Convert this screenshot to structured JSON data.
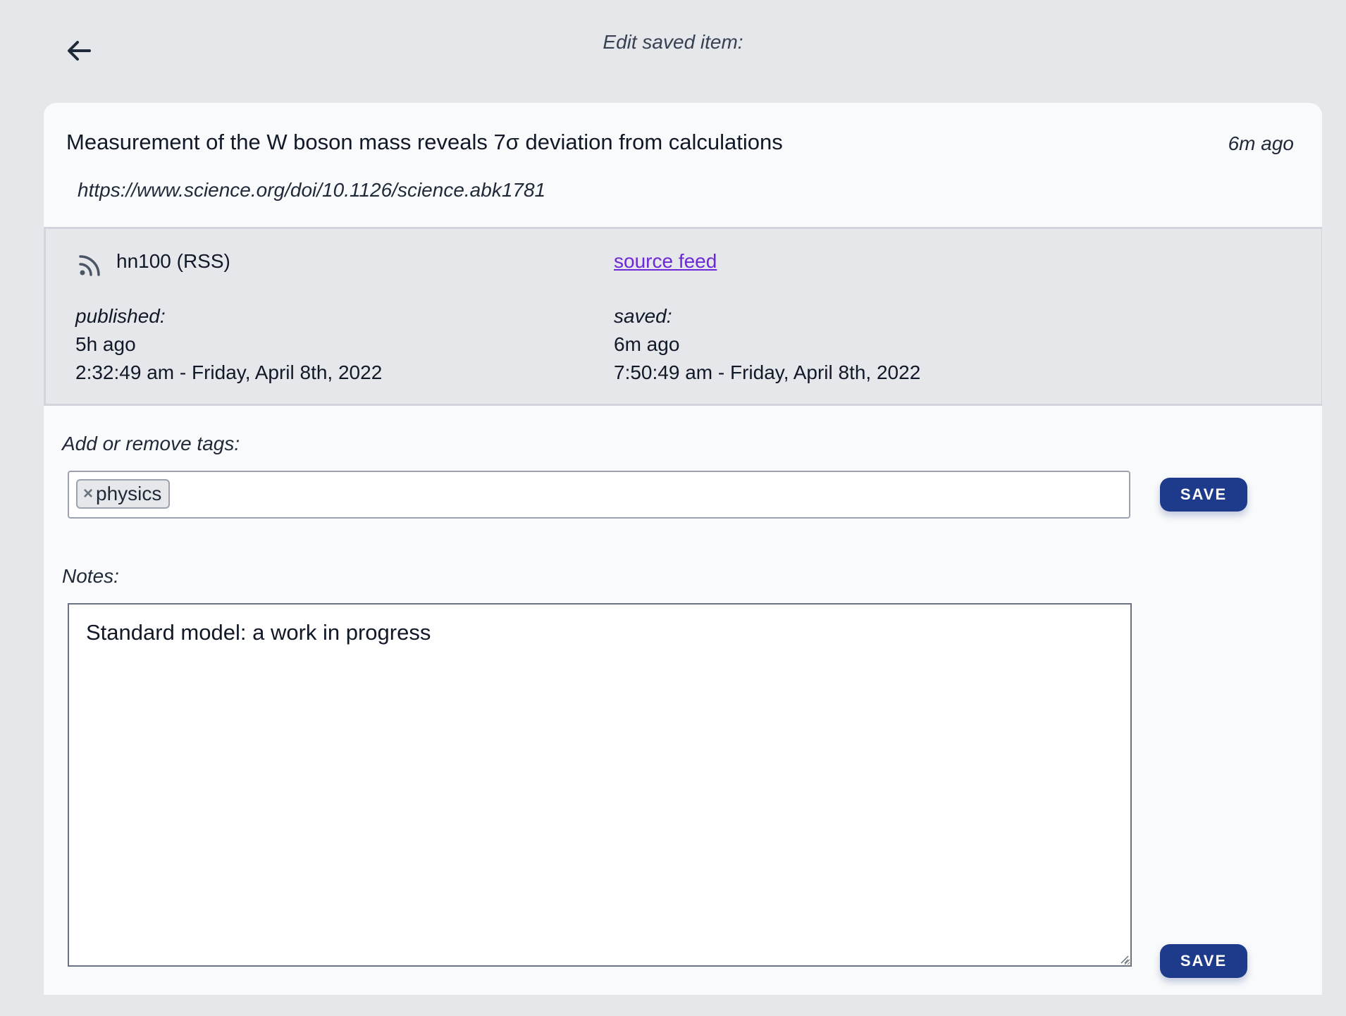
{
  "header": {
    "title": "Edit saved item:"
  },
  "item": {
    "title": "Measurement of the W boson mass reveals 7σ deviation from calculations",
    "age": "6m ago",
    "url": "https://www.science.org/doi/10.1126/science.abk1781"
  },
  "meta": {
    "feed_name": "hn100 (RSS)",
    "source_link": "source feed",
    "published_label": "published:",
    "published_relative": "5h ago",
    "published_absolute": "2:32:49 am - Friday, April 8th, 2022",
    "saved_label": "saved:",
    "saved_relative": "6m ago",
    "saved_absolute": "7:50:49 am - Friday, April 8th, 2022"
  },
  "tags": {
    "label": "Add or remove tags:",
    "items": [
      {
        "remove_glyph": "×",
        "name": "physics"
      }
    ],
    "save_label": "SAVE"
  },
  "notes": {
    "label": "Notes:",
    "value": "Standard model: a work in progress",
    "save_label": "SAVE"
  },
  "icons": {
    "back": "arrow-left-icon",
    "feed": "rss-icon",
    "tag_remove": "close-icon"
  },
  "colors": {
    "background": "#e5e7eb",
    "card": "#f9fafb",
    "accent": "#1e3a8a",
    "link": "#6d28d9"
  }
}
